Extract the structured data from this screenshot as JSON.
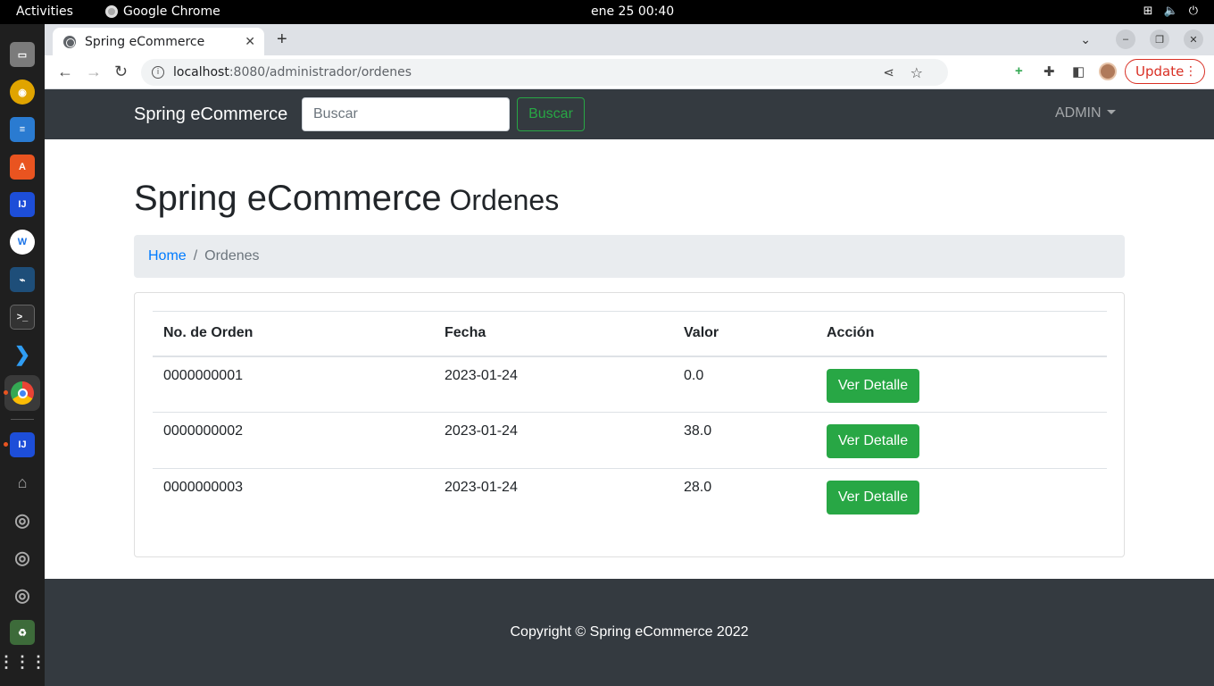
{
  "topbar": {
    "activities": "Activities",
    "app_name": "Google Chrome",
    "clock": "ene 25  00:40"
  },
  "dock": {
    "items": [
      "files-icon",
      "rhythmbox-icon",
      "writer-icon",
      "software-icon",
      "intellij-icon",
      "webstorm-icon",
      "mysql-workbench-icon",
      "terminal-icon",
      "vscode-icon",
      "chrome-icon",
      "intellij-running-icon",
      "usb-icon",
      "disk-icon",
      "disk-icon",
      "disk-icon",
      "trash-icon",
      "apps-grid-icon"
    ]
  },
  "browser": {
    "tab_title": "Spring eCommerce",
    "url_host": "localhost",
    "url_path": ":8080/administrador/ordenes",
    "update_label": "Update"
  },
  "navbar": {
    "brand": "Spring eCommerce",
    "search_placeholder": "Buscar",
    "search_button": "Buscar",
    "user_menu": "ADMIN"
  },
  "page": {
    "title_main": "Spring eCommerce",
    "title_sub": "Ordenes"
  },
  "breadcrumb": {
    "home": "Home",
    "separator": "/",
    "current": "Ordenes"
  },
  "table": {
    "headers": [
      "No. de Orden",
      "Fecha",
      "Valor",
      "Acción"
    ],
    "rows": [
      {
        "order": "0000000001",
        "date": "2023-01-24",
        "value": "0.0",
        "action": "Ver Detalle"
      },
      {
        "order": "0000000002",
        "date": "2023-01-24",
        "value": "38.0",
        "action": "Ver Detalle"
      },
      {
        "order": "0000000003",
        "date": "2023-01-24",
        "value": "28.0",
        "action": "Ver Detalle"
      }
    ]
  },
  "footer": {
    "copyright": "Copyright © Spring eCommerce 2022"
  },
  "colors": {
    "navbar_bg": "#343a40",
    "success": "#28a745",
    "link": "#007bff",
    "breadcrumb_bg": "#e9ecef"
  }
}
